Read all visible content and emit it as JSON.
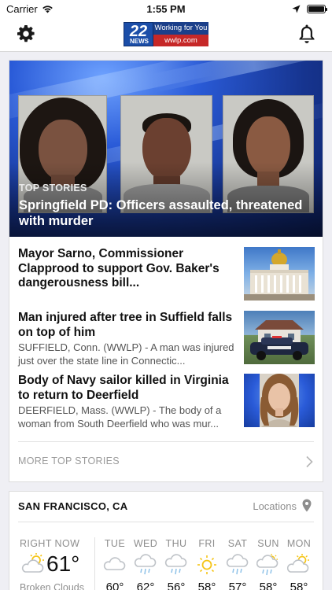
{
  "status_bar": {
    "carrier": "Carrier",
    "time": "1:55 PM"
  },
  "nav": {
    "logo_number": "22",
    "logo_news": "NEWS",
    "logo_tagline": "Working for You",
    "logo_url": "wwlp.com"
  },
  "hero": {
    "kicker": "TOP STORIES",
    "headline": "Springfield PD: Officers assaulted, threatened with murder"
  },
  "stories": [
    {
      "title": "Mayor Sarno, Commissioner Clapprood to support Gov. Baker's dangerousness bill...",
      "summary": ""
    },
    {
      "title": "Man injured after tree in Suffield falls on top of him",
      "summary": "SUFFIELD, Conn. (WWLP) - A man was injured just over the state line in Connectic..."
    },
    {
      "title": "Body of Navy sailor killed in Virginia to return to Deerfield",
      "summary": "DEERFIELD, Mass. (WWLP) - The body of a woman from South Deerfield who was mur..."
    }
  ],
  "more_link": "MORE TOP STORIES",
  "weather": {
    "city": "SAN FRANCISCO, CA",
    "locations_label": "Locations",
    "current": {
      "label": "RIGHT NOW",
      "temp": "61°",
      "condition": "Broken Clouds",
      "icon": "partly-cloudy-icon"
    },
    "forecast": [
      {
        "day": "TUE",
        "temp": "60°",
        "icon": "cloud-icon"
      },
      {
        "day": "WED",
        "temp": "62°",
        "icon": "rain-cloud-icon"
      },
      {
        "day": "THU",
        "temp": "56°",
        "icon": "rain-cloud-icon"
      },
      {
        "day": "FRI",
        "temp": "58°",
        "icon": "sun-icon"
      },
      {
        "day": "SAT",
        "temp": "57°",
        "icon": "rain-cloud-icon"
      },
      {
        "day": "SUN",
        "temp": "58°",
        "icon": "sun-rain-cloud-icon"
      },
      {
        "day": "MON",
        "temp": "58°",
        "icon": "partly-cloudy-icon"
      }
    ]
  },
  "colors": {
    "accent_blue": "#1b4ea8",
    "brand_red": "#c62828",
    "sun_yellow": "#f5c518",
    "icon_grey": "#bfc3c8",
    "rain_blue": "#8fc2e8"
  }
}
